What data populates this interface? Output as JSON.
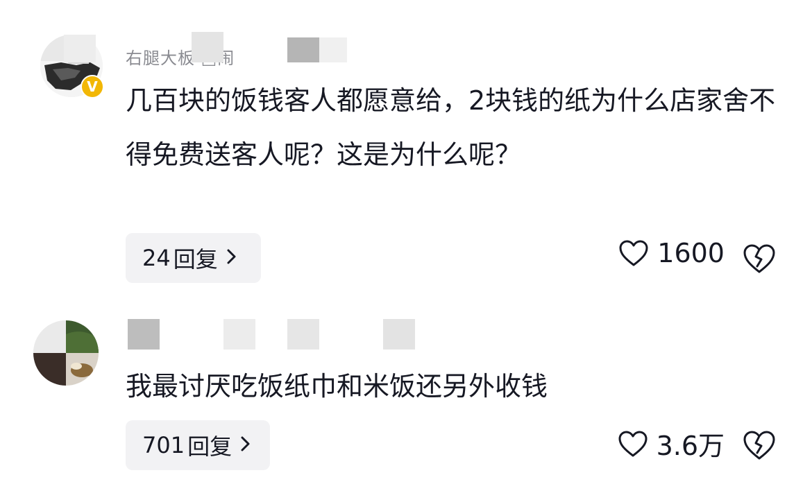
{
  "comments": [
    {
      "username": "右腿大板 □闹",
      "badge": "V",
      "text": "几百块的饭钱客人都愿意给，2块钱的纸为什么店家舍不得免费送客人呢？这是为什么呢？",
      "reply_count": "24",
      "reply_label": "回复",
      "likes": "1600"
    },
    {
      "username": "",
      "text": "我最讨厌吃饭纸巾和米饭还另外收钱",
      "reply_count": "701",
      "reply_label": "回复",
      "likes": "3.6万"
    }
  ],
  "icons": {
    "like": "heart-outline-icon",
    "dislike": "broken-heart-icon",
    "chevron": "chevron-right-icon",
    "verified": "verified-badge-icon"
  },
  "colors": {
    "text_primary": "#161823",
    "text_secondary": "#8a8b91",
    "reply_bg": "#f2f2f4",
    "badge": "#f2b705"
  }
}
